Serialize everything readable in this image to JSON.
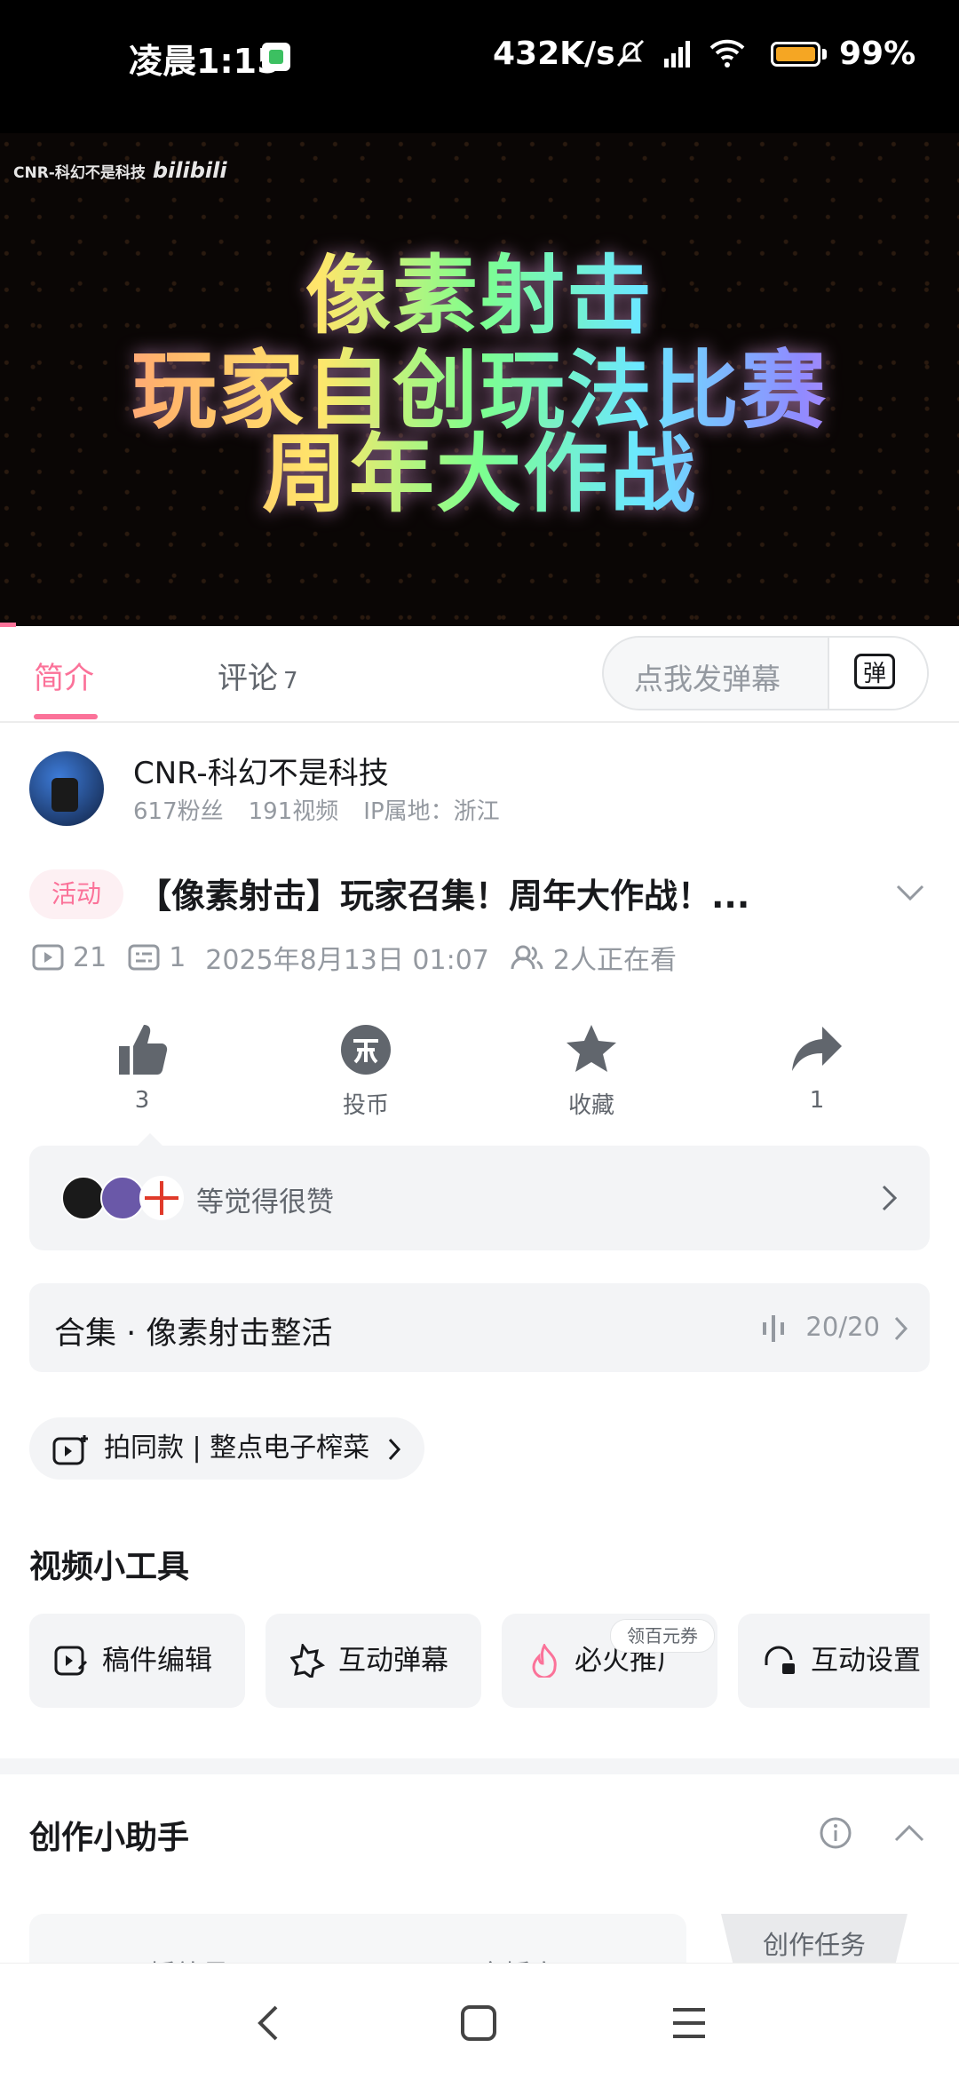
{
  "status_bar": {
    "time": "凌晨1:15",
    "net_speed": "432K/s",
    "battery": "99%"
  },
  "video": {
    "watermark": "CNR-科幻不是科技",
    "platform_logo": "bilibili",
    "title_lines": [
      "像素射击",
      "玩家自创玩法比赛",
      "周年大作战"
    ]
  },
  "tabs": {
    "intro": "简介",
    "comments": "评论",
    "comments_count": "7",
    "danmaku_placeholder": "点我发弹幕",
    "danmaku_icon_text": "弹"
  },
  "uploader": {
    "name": "CNR-科幻不是科技",
    "fans": "617粉丝",
    "videos": "191视频",
    "ip": "IP属地：浙江"
  },
  "video_info": {
    "tag": "活动",
    "title": "【像素射击】玩家召集！周年大作战！...",
    "plays": "21",
    "danmaku_count": "1",
    "date": "2025年8月13日 01:07",
    "watching": "2人正在看"
  },
  "actions": {
    "like": "3",
    "coin": "投币",
    "favorite": "收藏",
    "share": "1"
  },
  "liked_by": {
    "text": "等觉得很赞"
  },
  "collection": {
    "title": "合集 · 像素射击整活",
    "count": "20/20"
  },
  "same_style": {
    "label": "拍同款 | 整点电子榨菜"
  },
  "tools": {
    "heading": "视频小工具",
    "items": [
      "稿件编辑",
      "互动弹幕",
      "必火推广",
      "互动设置"
    ],
    "coupon": "领百元券"
  },
  "assistant": {
    "heading": "创作小助手",
    "task_tab": "创作任务",
    "metrics": [
      "播放量",
      "完播率"
    ]
  },
  "colors": {
    "accent": "#fb7299",
    "text": "#18191c",
    "muted": "#9499a0"
  }
}
